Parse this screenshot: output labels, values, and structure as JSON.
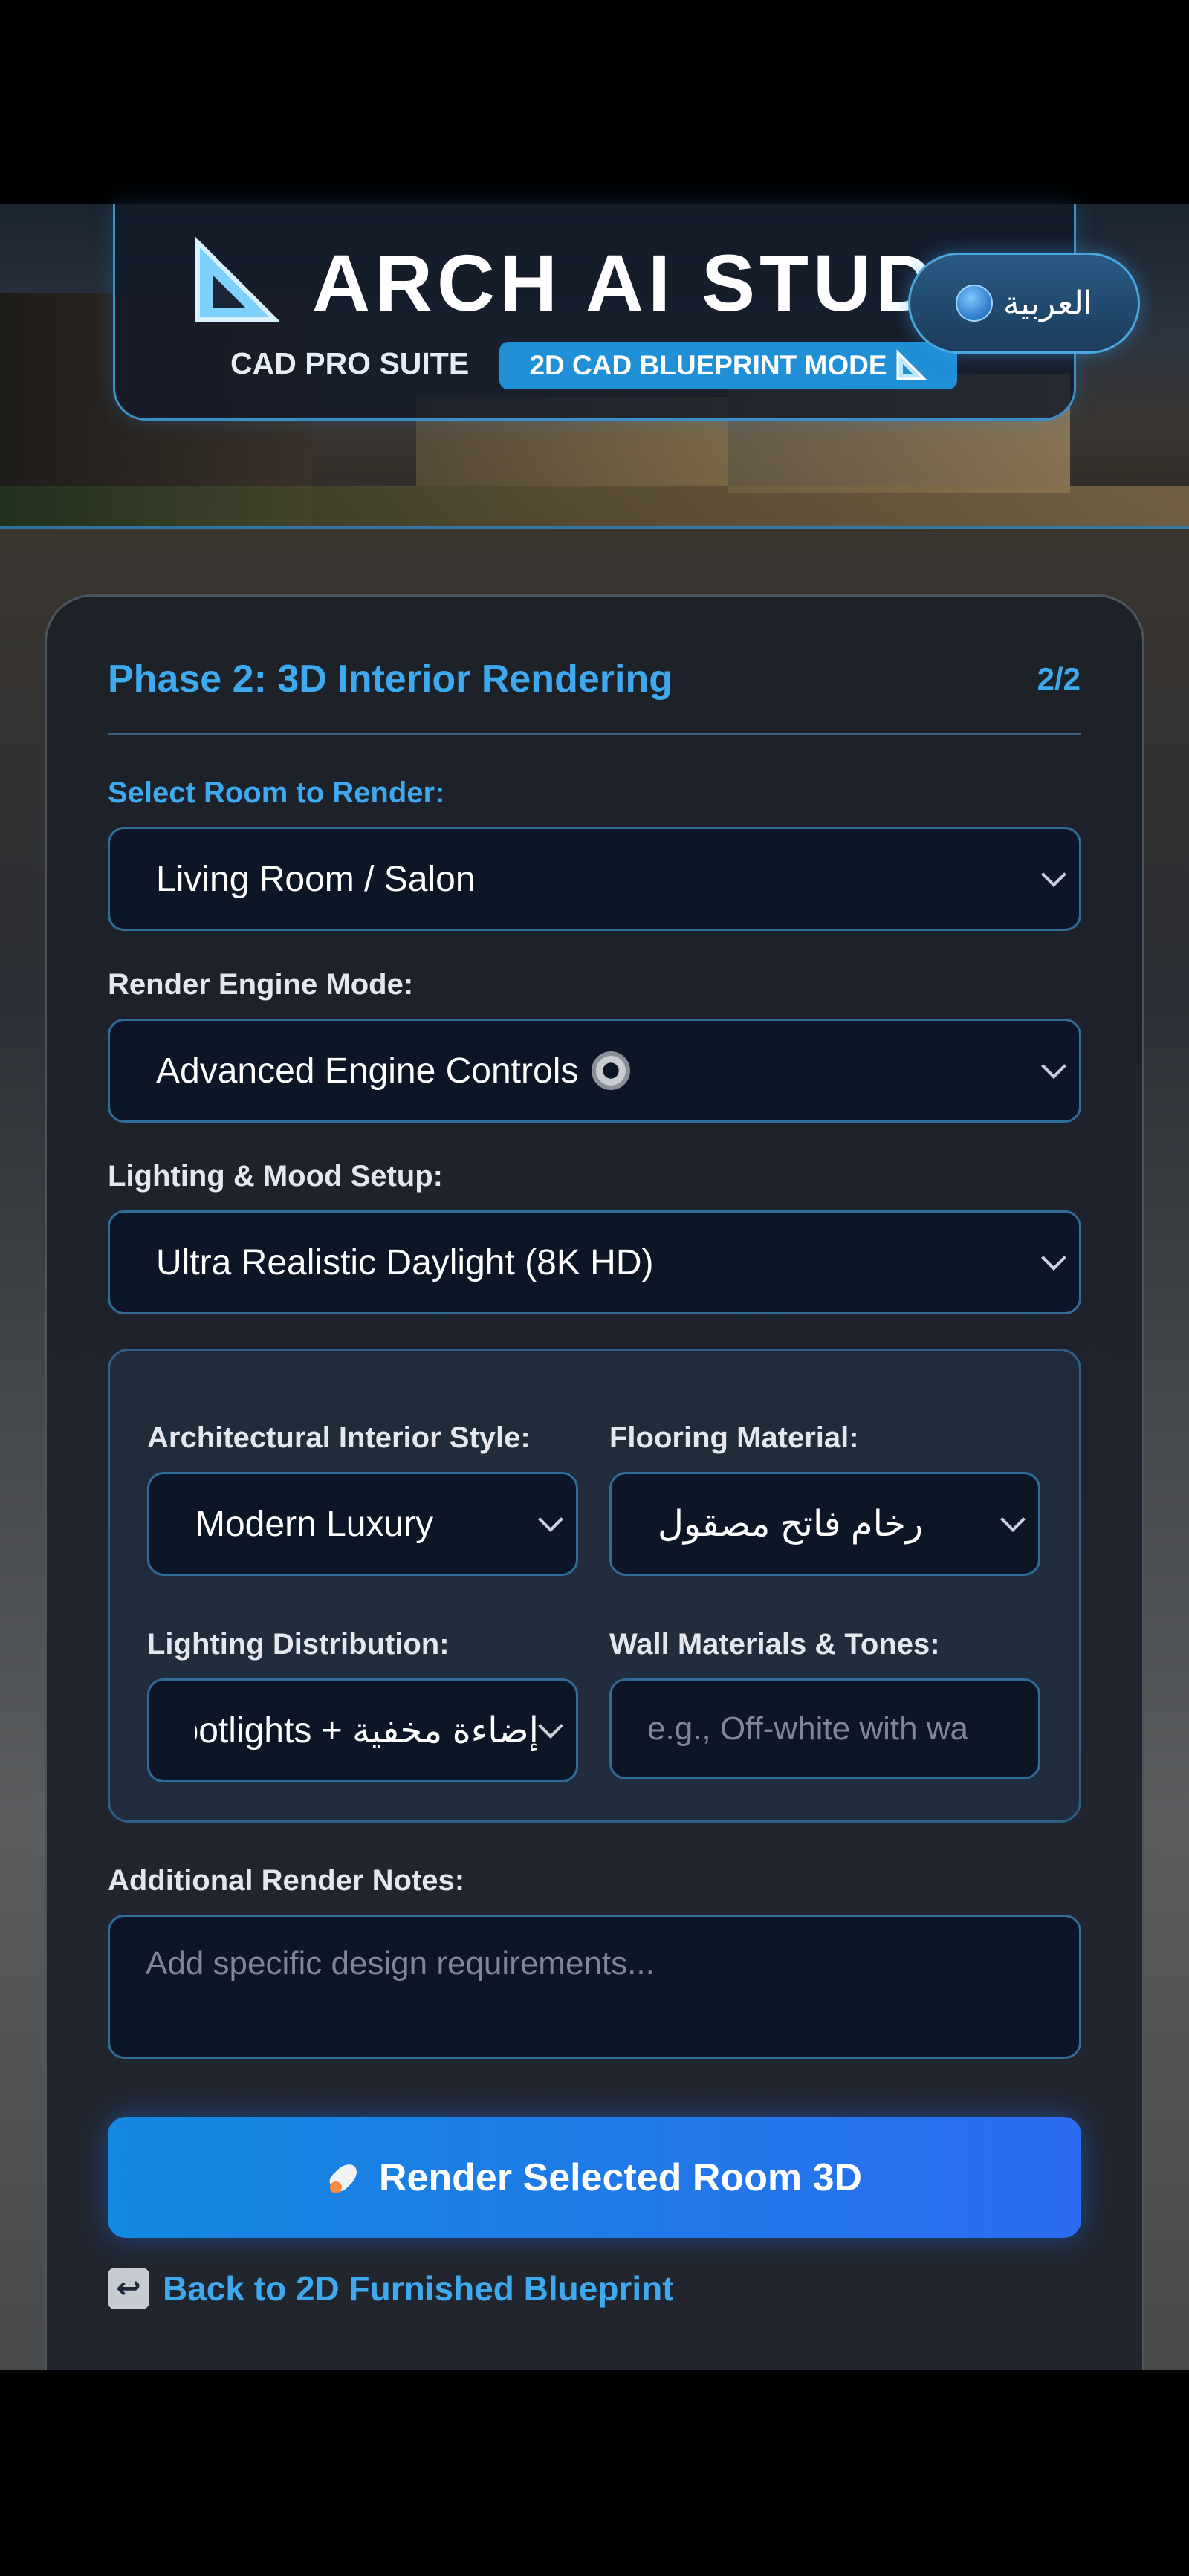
{
  "header": {
    "app_title": "ARCH AI STUDI",
    "suite_label": "CAD PRO SUITE",
    "mode_badge": "2D CAD BLUEPRINT MODE",
    "language_button": "العربية"
  },
  "phase": {
    "title": "Phase 2: 3D Interior Rendering",
    "step": "2/2"
  },
  "form": {
    "room_label": "Select Room to Render:",
    "room_value": "Living Room / Salon",
    "engine_label": "Render Engine Mode:",
    "engine_value": "Advanced Engine Controls",
    "lighting_label": "Lighting & Mood Setup:",
    "lighting_value": "Ultra Realistic Daylight (8K HD)",
    "advanced": {
      "style_label": "Architectural Interior Style:",
      "style_value": "Modern Luxury",
      "flooring_label": "Flooring Material:",
      "flooring_value": "رخام فاتح مصقول",
      "distribution_label": "Lighting Distribution:",
      "distribution_value": "إضاءة مخفية + Spotlights",
      "wall_label": "Wall Materials & Tones:",
      "wall_placeholder": "e.g., Off-white with wa"
    },
    "notes_label": "Additional Render Notes:",
    "notes_placeholder": "Add specific design requirements..."
  },
  "actions": {
    "render_button": "Render Selected Room 3D",
    "back_link": "Back to 2D Furnished Blueprint"
  },
  "colors": {
    "accent": "#3fa9ef",
    "button_start": "#1389df",
    "button_end": "#2b6cf0",
    "field_bg": "#0d1626"
  },
  "icons": [
    "set-square-icon",
    "globe-icon",
    "gear-icon",
    "rocket-icon",
    "back-arrow-icon",
    "chevron-down-icon"
  ]
}
